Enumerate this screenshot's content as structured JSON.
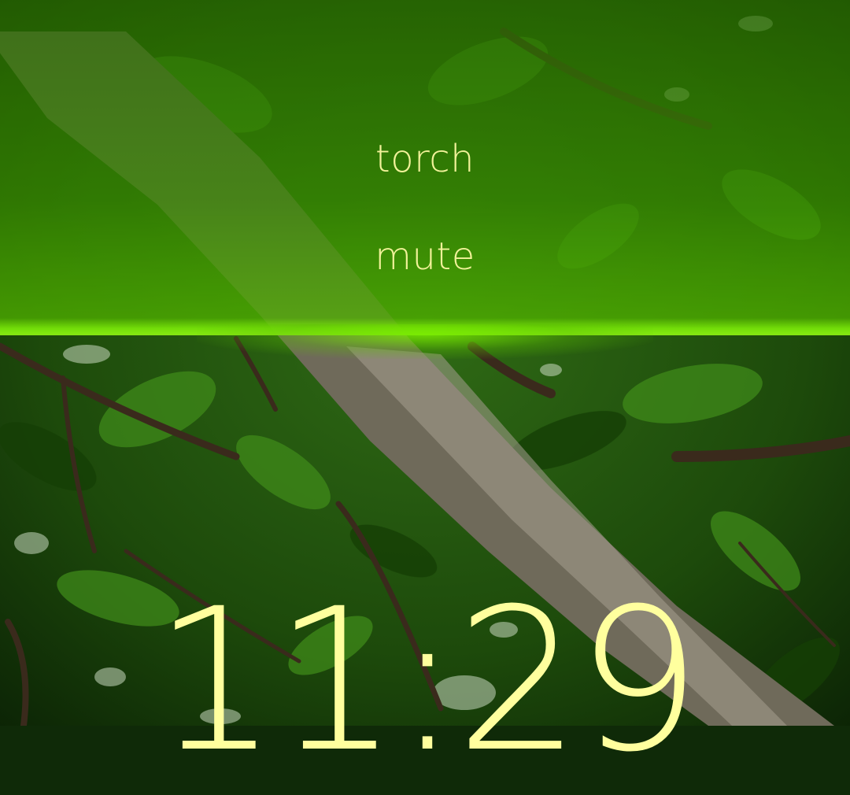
{
  "pulley_menu": {
    "items": [
      {
        "label": "torch"
      },
      {
        "label": "mute"
      }
    ]
  },
  "clock": {
    "time": "11:29"
  },
  "wallpaper": {
    "subject": "tree-branches-and-leaves"
  },
  "colors": {
    "accent": "#6ad000",
    "text_highlight": "#f2f29a",
    "clock_text": "#ffff9e"
  }
}
